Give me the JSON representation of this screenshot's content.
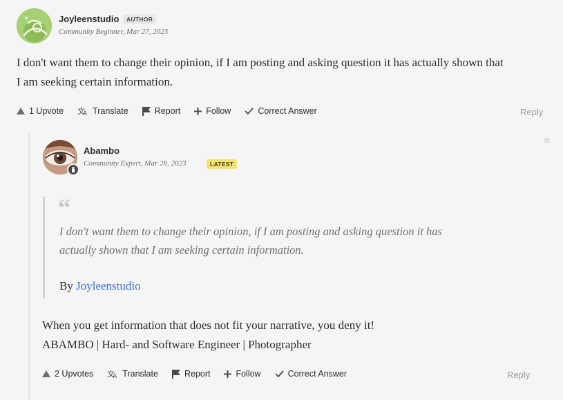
{
  "post1": {
    "author": "Joyleenstudio",
    "badge": "AUTHOR",
    "rank": "Community Beginner",
    "date": "Mar 27, 2023",
    "body_line1": "I don't want them to change their opinion, if I am posting and asking question it has actually shown that",
    "body_line2": "I am seeking certain information.",
    "actions": {
      "upvote": "1 Upvote",
      "translate": "Translate",
      "report": "Report",
      "follow": "Follow",
      "correct": "Correct Answer"
    },
    "reply": "Reply",
    "colors": {
      "badge_bg": "#e8e8e8",
      "avatar_bg": "#a7cf73"
    }
  },
  "post2": {
    "author": "Abambo",
    "rank": "Community Expert",
    "date": "Mar 28, 2023",
    "badge": "LATEST",
    "quote_line1": "I don't want them to change their opinion, if I am posting and asking question it has",
    "quote_line2": "actually shown that I am seeking certain information.",
    "by_label": "By",
    "by_author": "Joyleenstudio",
    "body_line1": "When you get information that does not fit your narrative, you deny it!",
    "body_line2": "ABAMBO | Hard- and Software Engineer | Photographer",
    "actions": {
      "upvote": "2 Upvotes",
      "translate": "Translate",
      "report": "Report",
      "follow": "Follow",
      "correct": "Correct Answer"
    },
    "reply": "Reply",
    "colors": {
      "badge_bg": "#f3e276",
      "link": "#3a72d6"
    }
  }
}
